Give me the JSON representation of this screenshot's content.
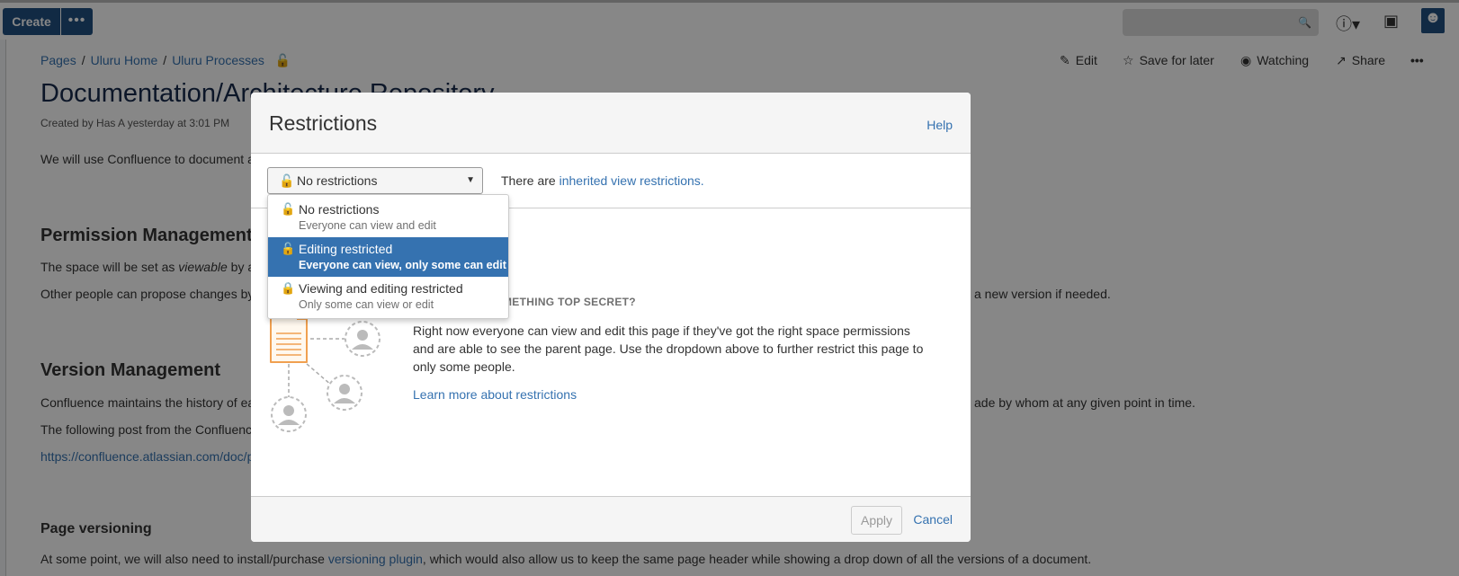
{
  "topnav": {
    "create_label": "Create",
    "more_label": "•••",
    "search_placeholder": "",
    "help_icon": "?",
    "notifications_icon": "tray",
    "avatar_icon": "user"
  },
  "breadcrumbs": [
    "Pages",
    "Uluru Home",
    "Uluru Processes"
  ],
  "page_actions": {
    "edit": "Edit",
    "save_for_later": "Save for later",
    "watching": "Watching",
    "share": "Share",
    "more": "•••"
  },
  "page": {
    "title": "Documentation/Architecture Repository",
    "byline": "Created by Has A yesterday at 3:01 PM",
    "intro": "We will use Confluence to document a",
    "permission_heading": "Permission Management",
    "permission_p1_start": "The space will be set as ",
    "permission_p1_em": "viewable",
    "permission_p1_end": " by a",
    "permission_p2": "Other people can propose changes by",
    "permission_p2_tail": "a new version if needed.",
    "version_heading": "Version Management",
    "version_p1": "Confluence maintains the history of ea",
    "version_p1_tail": "ade by whom at any given point in time.",
    "version_p2": "The following post from the Confluenc",
    "version_link": "https://confluence.atlassian.com/doc/p",
    "versioning_heading": "Page versioning",
    "versioning_p_start": "At some point, we will also need to install/purchase ",
    "versioning_p_link": "versioning plugin",
    "versioning_p_end": ", which would also allow us to keep the same page header while showing a drop down of all the versions of a document."
  },
  "dialog": {
    "title": "Restrictions",
    "help": "Help",
    "select_value": "No restrictions",
    "inherited_prefix": "There are ",
    "inherited_link": "inherited view restrictions.",
    "secret_heading": "METHING TOP SECRET?",
    "secret_body": "Right now everyone can view and edit this page if they've got the right space permissions and are able to see the parent page. Use the dropdown above to further restrict this page to only some people.",
    "learn_more": "Learn more about restrictions",
    "apply": "Apply",
    "cancel": "Cancel"
  },
  "dropdown": {
    "options": [
      {
        "label": "No restrictions",
        "sub": "Everyone can view and edit",
        "icon": "unlock-icon",
        "selected": false
      },
      {
        "label": "Editing restricted",
        "sub": "Everyone can view, only some can edit",
        "icon": "unlock-icon",
        "selected": true
      },
      {
        "label": "Viewing and editing restricted",
        "sub": "Only some can view or edit",
        "icon": "lock-icon",
        "selected": false
      }
    ]
  },
  "colors": {
    "brand": "#205081",
    "link": "#3572b0",
    "lock_red": "#d04437",
    "selected_bg": "#3572b0",
    "illustration_orange": "#f0a050"
  }
}
